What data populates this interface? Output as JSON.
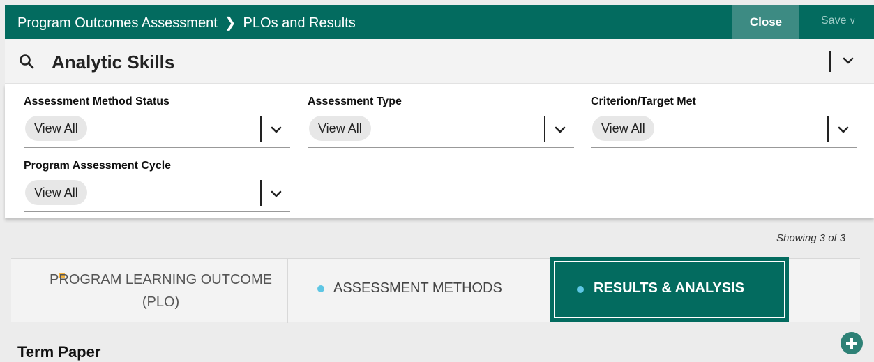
{
  "header": {
    "breadcrumb_parent": "Program Outcomes Assessment",
    "breadcrumb_current": "PLOs and Results",
    "close_label": "Close",
    "save_label": "Save"
  },
  "search": {
    "title": "Analytic Skills"
  },
  "filters": [
    {
      "label": "Assessment Method Status",
      "value": "View All"
    },
    {
      "label": "Assessment Type",
      "value": "View All"
    },
    {
      "label": "Criterion/Target Met",
      "value": "View All"
    },
    {
      "label": "Program Assessment Cycle",
      "value": "View All"
    }
  ],
  "results": {
    "showing": "Showing 3 of 3"
  },
  "tabs": [
    {
      "label": "PROGRAM LEARNING OUTCOME (PLO)",
      "indicator_color": "#f5b23c"
    },
    {
      "label": "ASSESSMENT METHODS",
      "indicator_color": "#5ec6e4"
    },
    {
      "label": "RESULTS & ANALYSIS",
      "indicator_color": "#5ec6e4",
      "selected": true
    }
  ],
  "section": {
    "title": "Term Paper"
  },
  "colors": {
    "brand": "#036b5f",
    "close_button": "#3d8b83",
    "add_button": "#2e8176"
  },
  "icons": {
    "search": "search-icon",
    "chevron": "chevron-down-icon",
    "add": "plus-circle-icon",
    "arrow": "chevron-right-icon"
  }
}
